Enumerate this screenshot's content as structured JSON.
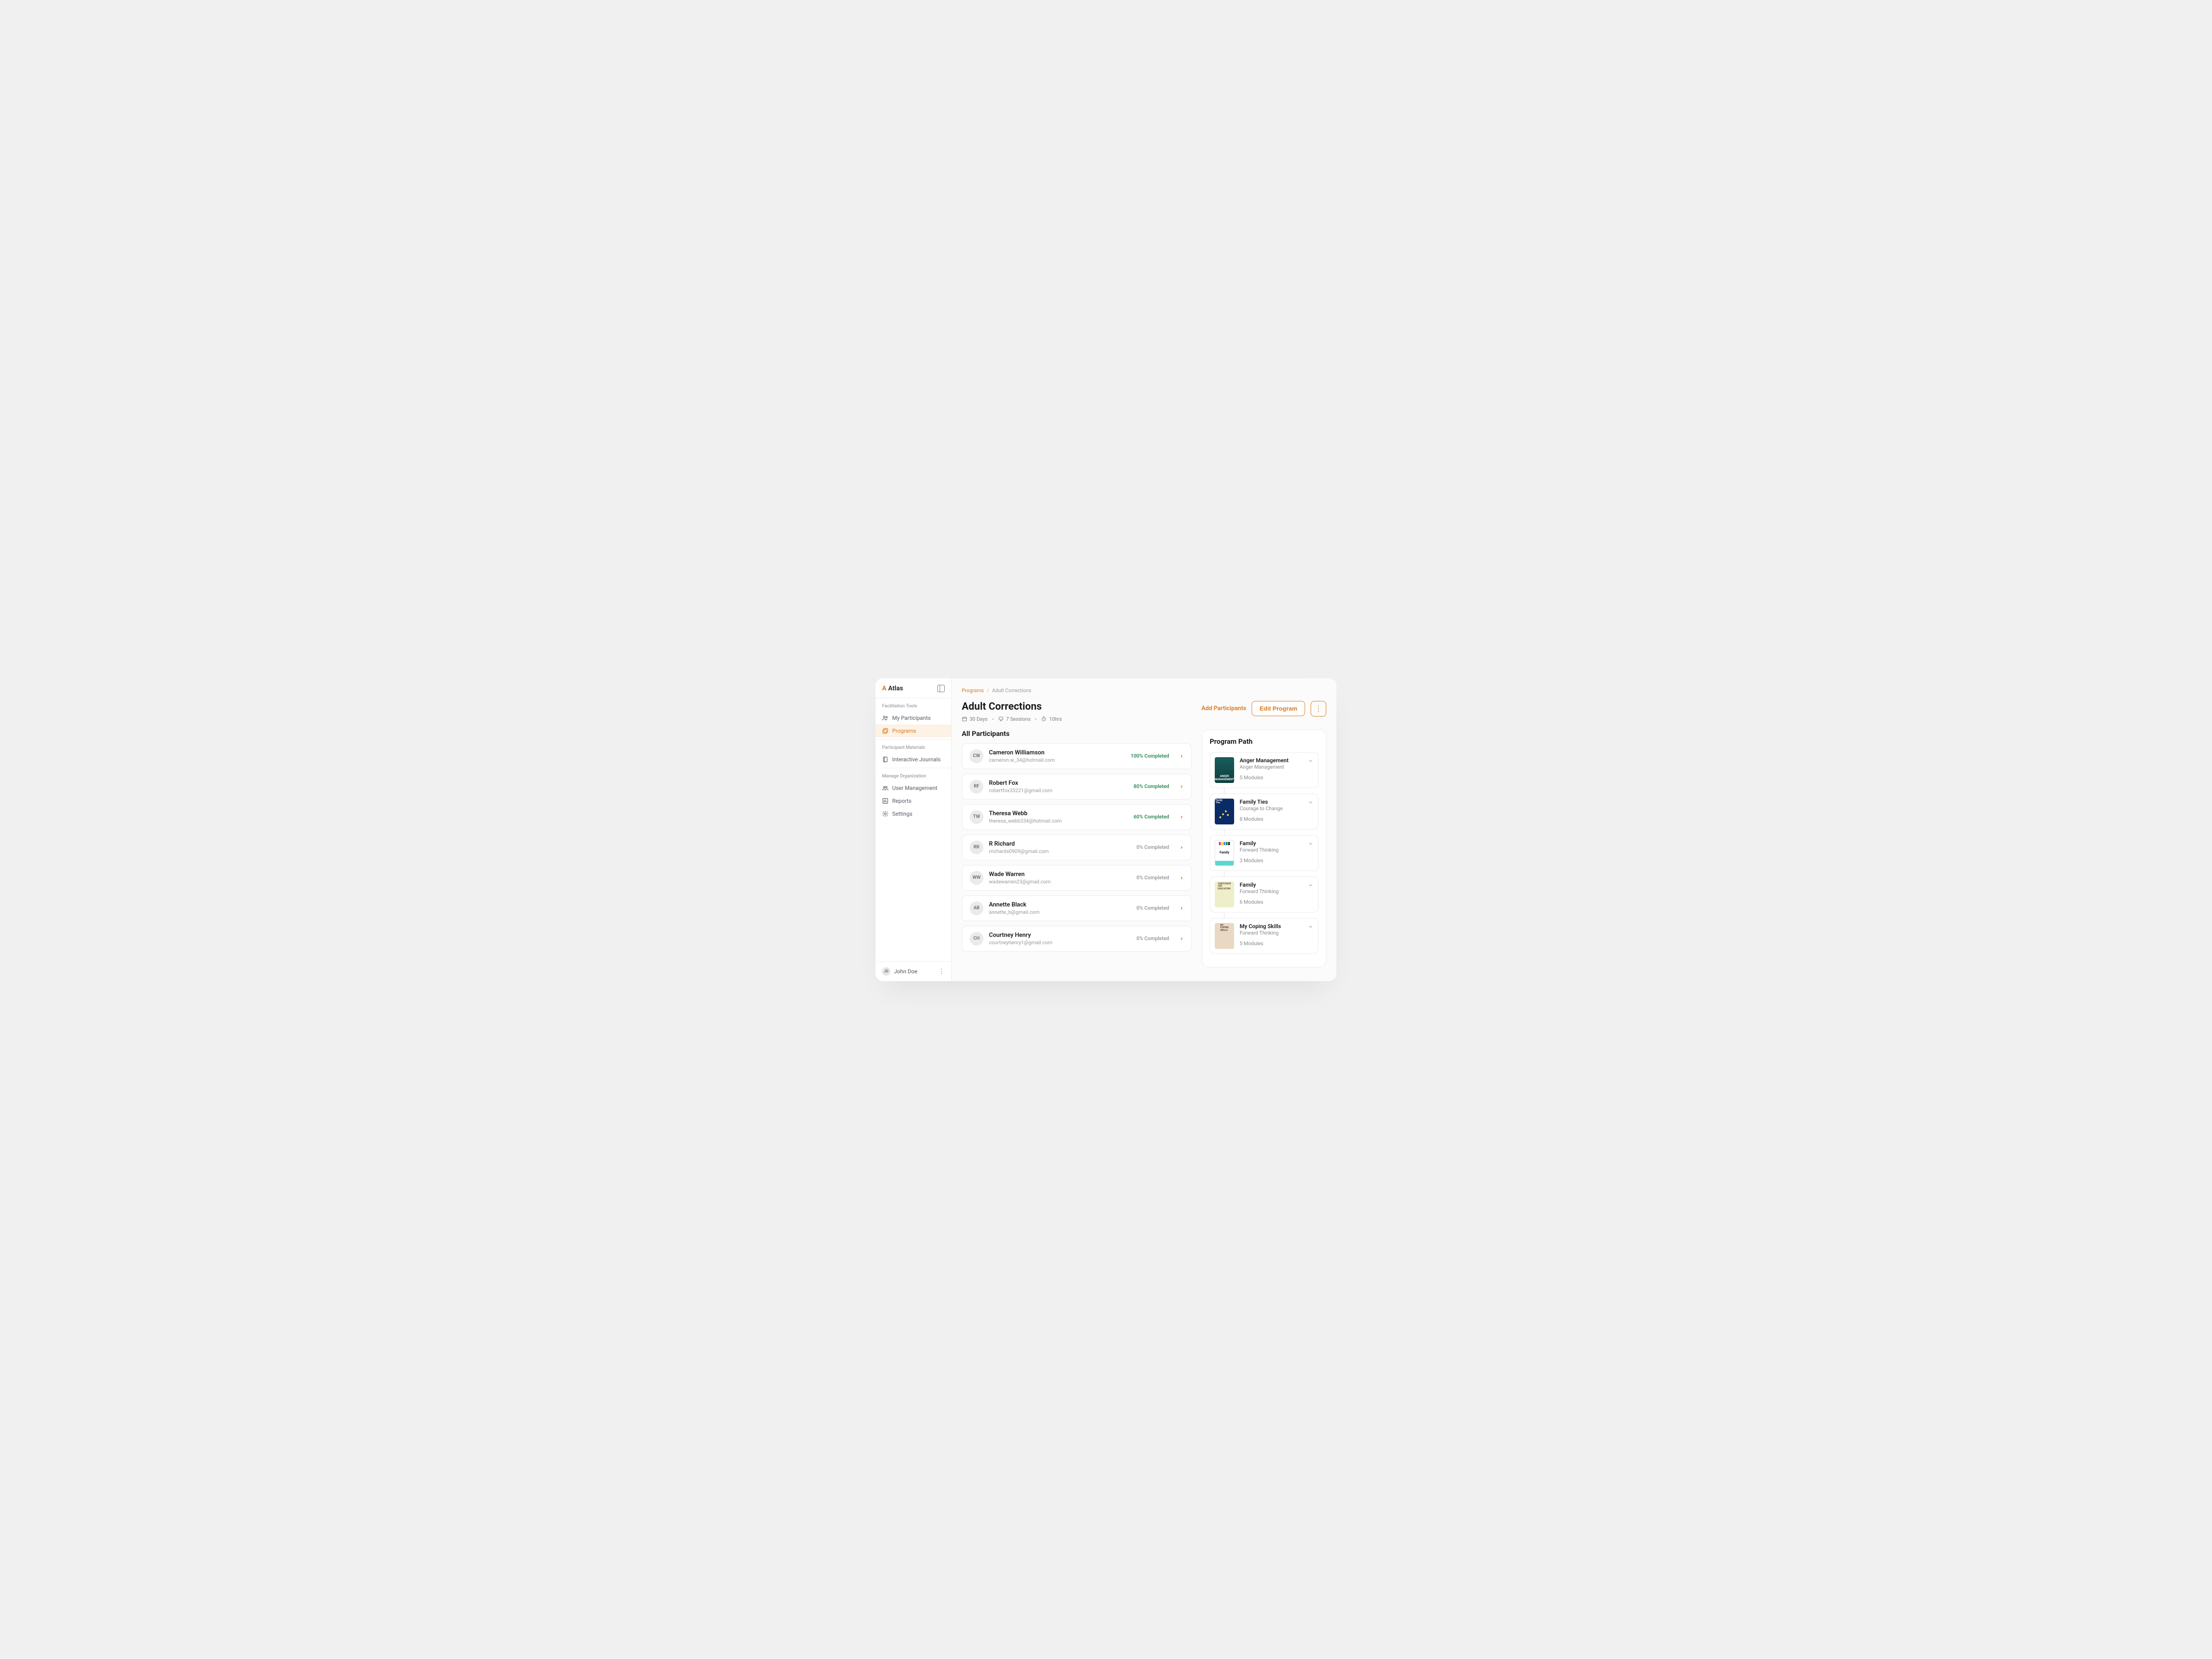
{
  "brand": {
    "name": "Atlas"
  },
  "sidebar": {
    "sections": [
      {
        "title": "Facilitation Tools",
        "items": [
          {
            "label": "My Participants",
            "icon": "users"
          },
          {
            "label": "Programs",
            "icon": "layers",
            "active": true
          }
        ]
      },
      {
        "title": "Participant Materials",
        "items": [
          {
            "label": "Interactive Journals",
            "icon": "journal"
          }
        ]
      },
      {
        "title": "Manage Organization",
        "items": [
          {
            "label": "User Management",
            "icon": "people"
          },
          {
            "label": "Reports",
            "icon": "chart"
          },
          {
            "label": "Settings",
            "icon": "gear"
          }
        ]
      }
    ],
    "footer": {
      "initials": "JD",
      "name": "John Doe"
    }
  },
  "breadcrumb": {
    "root": "Programs",
    "current": "Adult Corrections"
  },
  "page": {
    "title": "Adult Corrections",
    "meta": {
      "days": "30 Days",
      "sessions": "7 Sessions",
      "hours": "10hrs"
    },
    "actions": {
      "add": "Add Participants",
      "edit": "Edit Program"
    }
  },
  "participants": {
    "heading": "All Participants",
    "list": [
      {
        "initials": "CW",
        "name": "Cameron Williamson",
        "email": "cameron.w_34@hotmail.com",
        "status": "100% Completed",
        "tone": "green"
      },
      {
        "initials": "RF",
        "name": "Robert Fox",
        "email": "robertfox33221@gmail.com",
        "status": "80% Completed",
        "tone": "green"
      },
      {
        "initials": "TW",
        "name": "Theresa Webb",
        "email": "theresa_webb334@hotmail.com",
        "status": "60% Completed",
        "tone": "green"
      },
      {
        "initials": "RR",
        "name": "R Richard",
        "email": "rrichards0909@gmail.com",
        "status": "0% Completed",
        "tone": "gray"
      },
      {
        "initials": "WW",
        "name": "Wade Warren",
        "email": "wadewarren23@gmail.com",
        "status": "0% Completed",
        "tone": "gray"
      },
      {
        "initials": "AB",
        "name": "Annette Black",
        "email": "annette_b@gmail.com",
        "status": "0% Completed",
        "tone": "gray"
      },
      {
        "initials": "CH",
        "name": "Courtney Henry",
        "email": "courtneyhenry1@gmail.com",
        "status": "0% Completed",
        "tone": "gray"
      }
    ]
  },
  "programPath": {
    "heading": "Program Path",
    "items": [
      {
        "title": "Anger Management",
        "subtitle": "Anger Management",
        "modules": "5 Modules",
        "cover": "anger",
        "coverLabel": "ANGER\nMANAGEMENT"
      },
      {
        "title": "Family Ties",
        "subtitle": "Courage to Change",
        "modules": "8 Modules",
        "cover": "family-ties",
        "coverLabel": "Family\nTies"
      },
      {
        "title": "Family",
        "subtitle": "Forward Thinking",
        "modules": "3 Modules",
        "cover": "family",
        "coverLabel": "Family"
      },
      {
        "title": "Family",
        "subtitle": "Forward Thinking",
        "modules": "6 Modules",
        "cover": "substance",
        "coverLabel": "SUBSTANCE\nUSE\nEDUCATION"
      },
      {
        "title": "My Coping Skills",
        "subtitle": "Forward Thinking",
        "modules": "5 Modules",
        "cover": "coping",
        "coverLabel": "MY\nCOPING\nSKILLS"
      }
    ]
  }
}
